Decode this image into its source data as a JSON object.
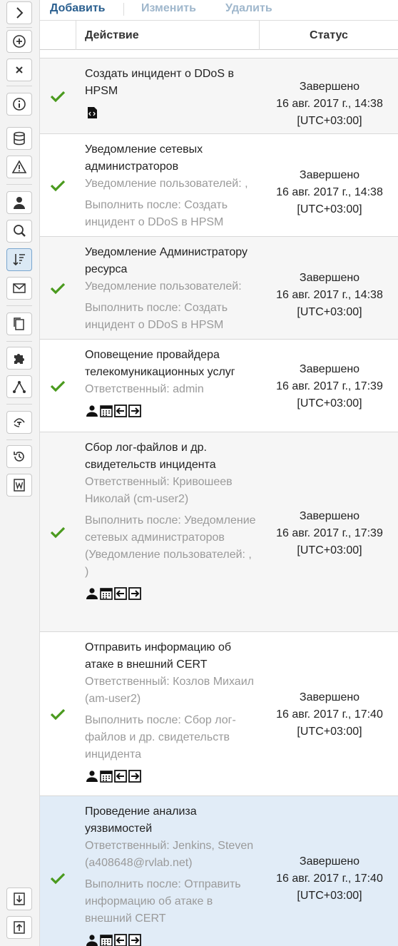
{
  "toolbar": {
    "add_label": "Добавить",
    "edit_label": "Изменить",
    "delete_label": "Удалить"
  },
  "columns": {
    "action": "Действие",
    "status": "Статус"
  },
  "colors": {
    "accent": "#2a5f8f",
    "disabled": "#9fb7cc",
    "check": "#4a9a1e",
    "selected_row": "#e1ecf7"
  },
  "sidebar": [
    "expand-icon",
    "add-circle-icon",
    "close-icon",
    "info-icon",
    "database-icon",
    "warning-icon",
    "user-icon",
    "search-user-icon",
    "sort-icon",
    "envelope-icon",
    "copy-icon",
    "puzzle-icon",
    "graph-icon",
    "link-icon",
    "history-icon",
    "word-icon",
    "download-icon",
    "upload-icon"
  ],
  "rows": [
    {
      "title": "Создать инцидент о DDoS в HPSM",
      "meta": [],
      "icons": [
        "script-icon"
      ],
      "status": [
        "Завершено",
        "16 авг. 2017 г., 14:38",
        "[UTC+03:00]"
      ]
    },
    {
      "title": "Уведомление сетевых администраторов",
      "meta": [
        "Уведомление пользователей: ,",
        "Выполнить после: Создать инцидент о DDoS в HPSM"
      ],
      "icons": [],
      "status": [
        "Завершено",
        "16 авг. 2017 г., 14:38",
        "[UTC+03:00]"
      ]
    },
    {
      "title": "Уведомление Администратору ресурса",
      "meta": [
        "Уведомление пользователей:",
        "Выполнить после: Создать инцидент о DDoS в HPSM"
      ],
      "icons": [],
      "status": [
        "Завершено",
        "16 авг. 2017 г., 14:38",
        "[UTC+03:00]"
      ]
    },
    {
      "title": "Оповещение провайдера телекомуникационных услуг",
      "meta": [
        "Ответственный: admin"
      ],
      "icons": [
        "user-icon",
        "calendar-icon",
        "arrow-left-icon",
        "arrow-right-icon"
      ],
      "status": [
        "Завершено",
        "16 авг. 2017 г., 17:39",
        "[UTC+03:00]"
      ]
    },
    {
      "title": "Сбор лог-файлов и др. свидетельств инцидента",
      "meta": [
        "Ответственный: Кривошеев Николай (cm-user2)",
        "Выполнить после: Уведомление сетевых администраторов (Уведомление пользователей: , )"
      ],
      "icons": [
        "user-icon",
        "calendar-icon",
        "arrow-left-icon",
        "arrow-right-icon"
      ],
      "status": [
        "Завершено",
        "16 авг. 2017 г., 17:39",
        "[UTC+03:00]"
      ]
    },
    {
      "title": "Отправить информацию об атаке в внешний CERT",
      "meta": [
        "Ответственный: Козлов Михаил (am-user2)",
        "Выполнить после: Сбор лог-файлов и др. свидетельств инцидента"
      ],
      "icons": [
        "user-icon",
        "calendar-icon",
        "arrow-left-icon",
        "arrow-right-icon"
      ],
      "status": [
        "Завершено",
        "16 авг. 2017 г., 17:40",
        "[UTC+03:00]"
      ]
    },
    {
      "title": "Проведение анализа уязвимостей",
      "meta": [
        "Ответственный: Jenkins, Steven (a408648@rvlab.net)",
        "Выполнить после: Отправить информацию об атаке в внешний CERT"
      ],
      "icons": [
        "user-icon",
        "calendar-icon",
        "arrow-left-icon",
        "arrow-right-icon"
      ],
      "status": [
        "Завершено",
        "16 авг. 2017 г., 17:40",
        "[UTC+03:00]"
      ]
    }
  ]
}
